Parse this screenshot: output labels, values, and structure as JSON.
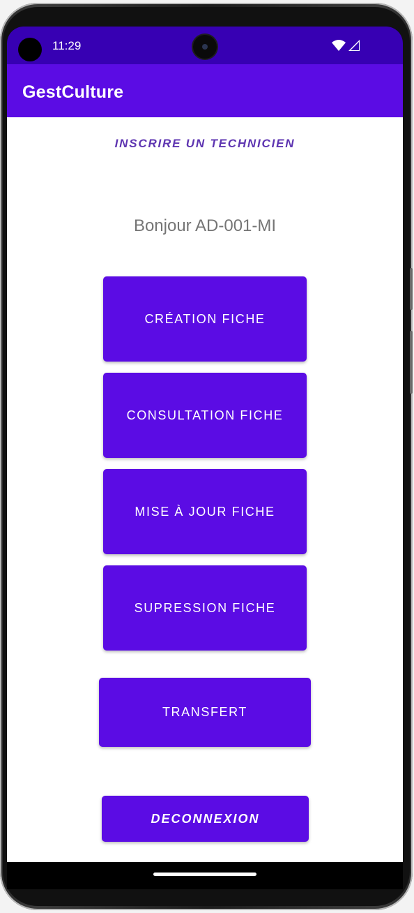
{
  "status_bar": {
    "time": "11:29",
    "icons": [
      "wifi-icon",
      "cellular-signal-icon"
    ]
  },
  "app_bar": {
    "title": "GestCulture"
  },
  "main": {
    "register_link": "INSCRIRE UN TECHNICIEN",
    "greeting": "Bonjour AD-001-MI",
    "buttons": {
      "creation": "CRÉATION FICHE",
      "consultation": "CONSULTATION FICHE",
      "update": "MISE À JOUR FICHE",
      "delete": "SUPRESSION FICHE",
      "transfer": "TRANSFERT",
      "logout": "DECONNEXION"
    }
  },
  "colors": {
    "status_bar": "#3700b3",
    "primary": "#5b0ce4",
    "link": "#5e35b1",
    "greeting_text": "#757575"
  }
}
